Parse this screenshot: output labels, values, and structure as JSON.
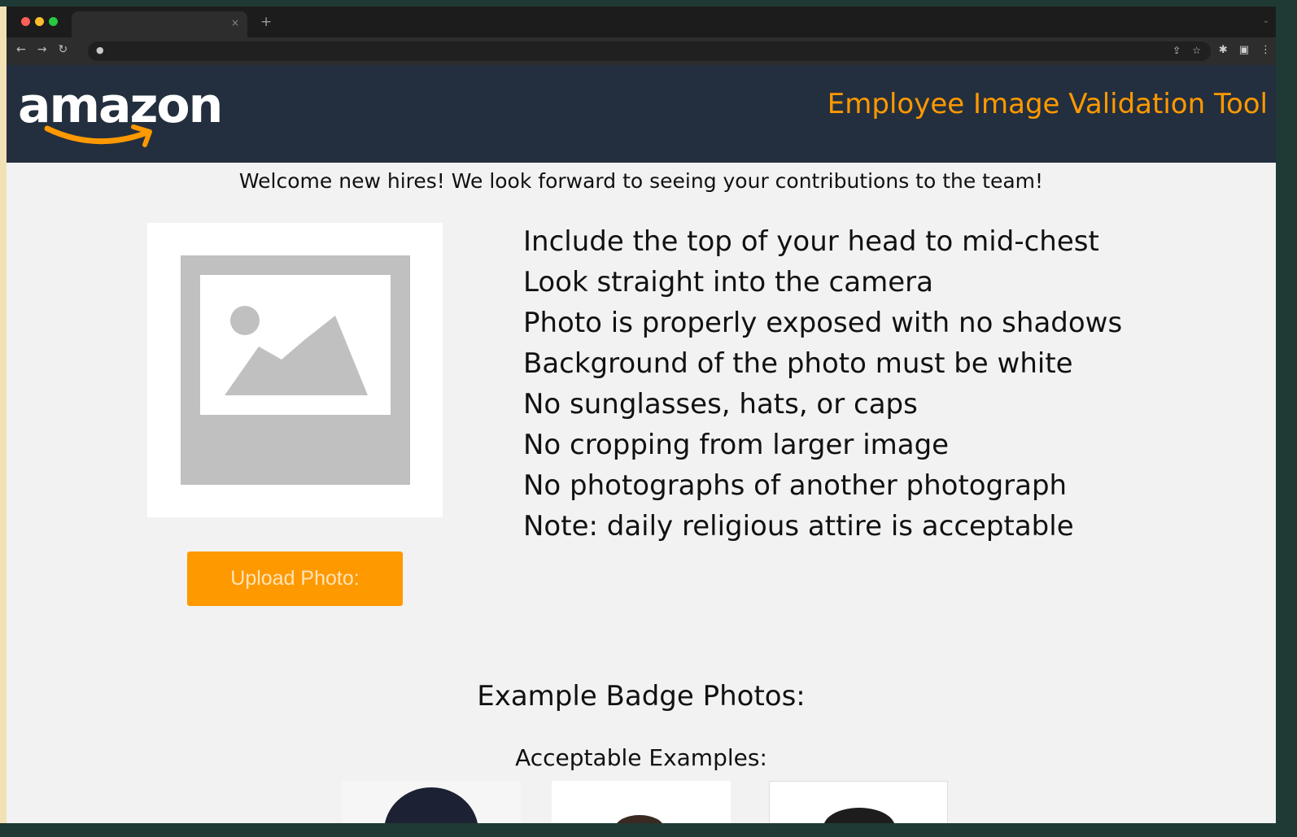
{
  "browser": {
    "tab_close_glyph": "×",
    "new_tab_glyph": "+",
    "tab_menu_glyph": "⌄",
    "nav": {
      "back": "←",
      "forward": "→",
      "reload": "↻"
    },
    "lock_glyph": "🔒",
    "omnibox_icons": {
      "share": "⇪",
      "bookmark": "☆"
    },
    "extension_icons": {
      "puzzle": "✱",
      "sidepanel": "▣",
      "menu": "⋮"
    },
    "traffic_colors": {
      "close": "#ff5f56",
      "minimize": "#ffbd2e",
      "maximize": "#27c93f"
    }
  },
  "header": {
    "logo_text": "amazon",
    "title": "Employee Image Validation Tool",
    "background": "#232f3e",
    "accent": "#ff9900"
  },
  "welcome_text": "Welcome new hires! We look forward to seeing your contributions to the team!",
  "guidelines": [
    "Include the top of your head to mid-chest",
    "Look straight into the camera",
    "Photo is properly exposed with no shadows",
    "Background of the photo must be white",
    "No sunglasses, hats, or caps",
    "No cropping from larger image",
    "No photographs of another photograph",
    "Note: daily religious attire is acceptable"
  ],
  "upload_button": "Upload Photo:",
  "examples": {
    "heading": "Example Badge Photos:",
    "acceptable_heading": "Acceptable Examples:"
  }
}
